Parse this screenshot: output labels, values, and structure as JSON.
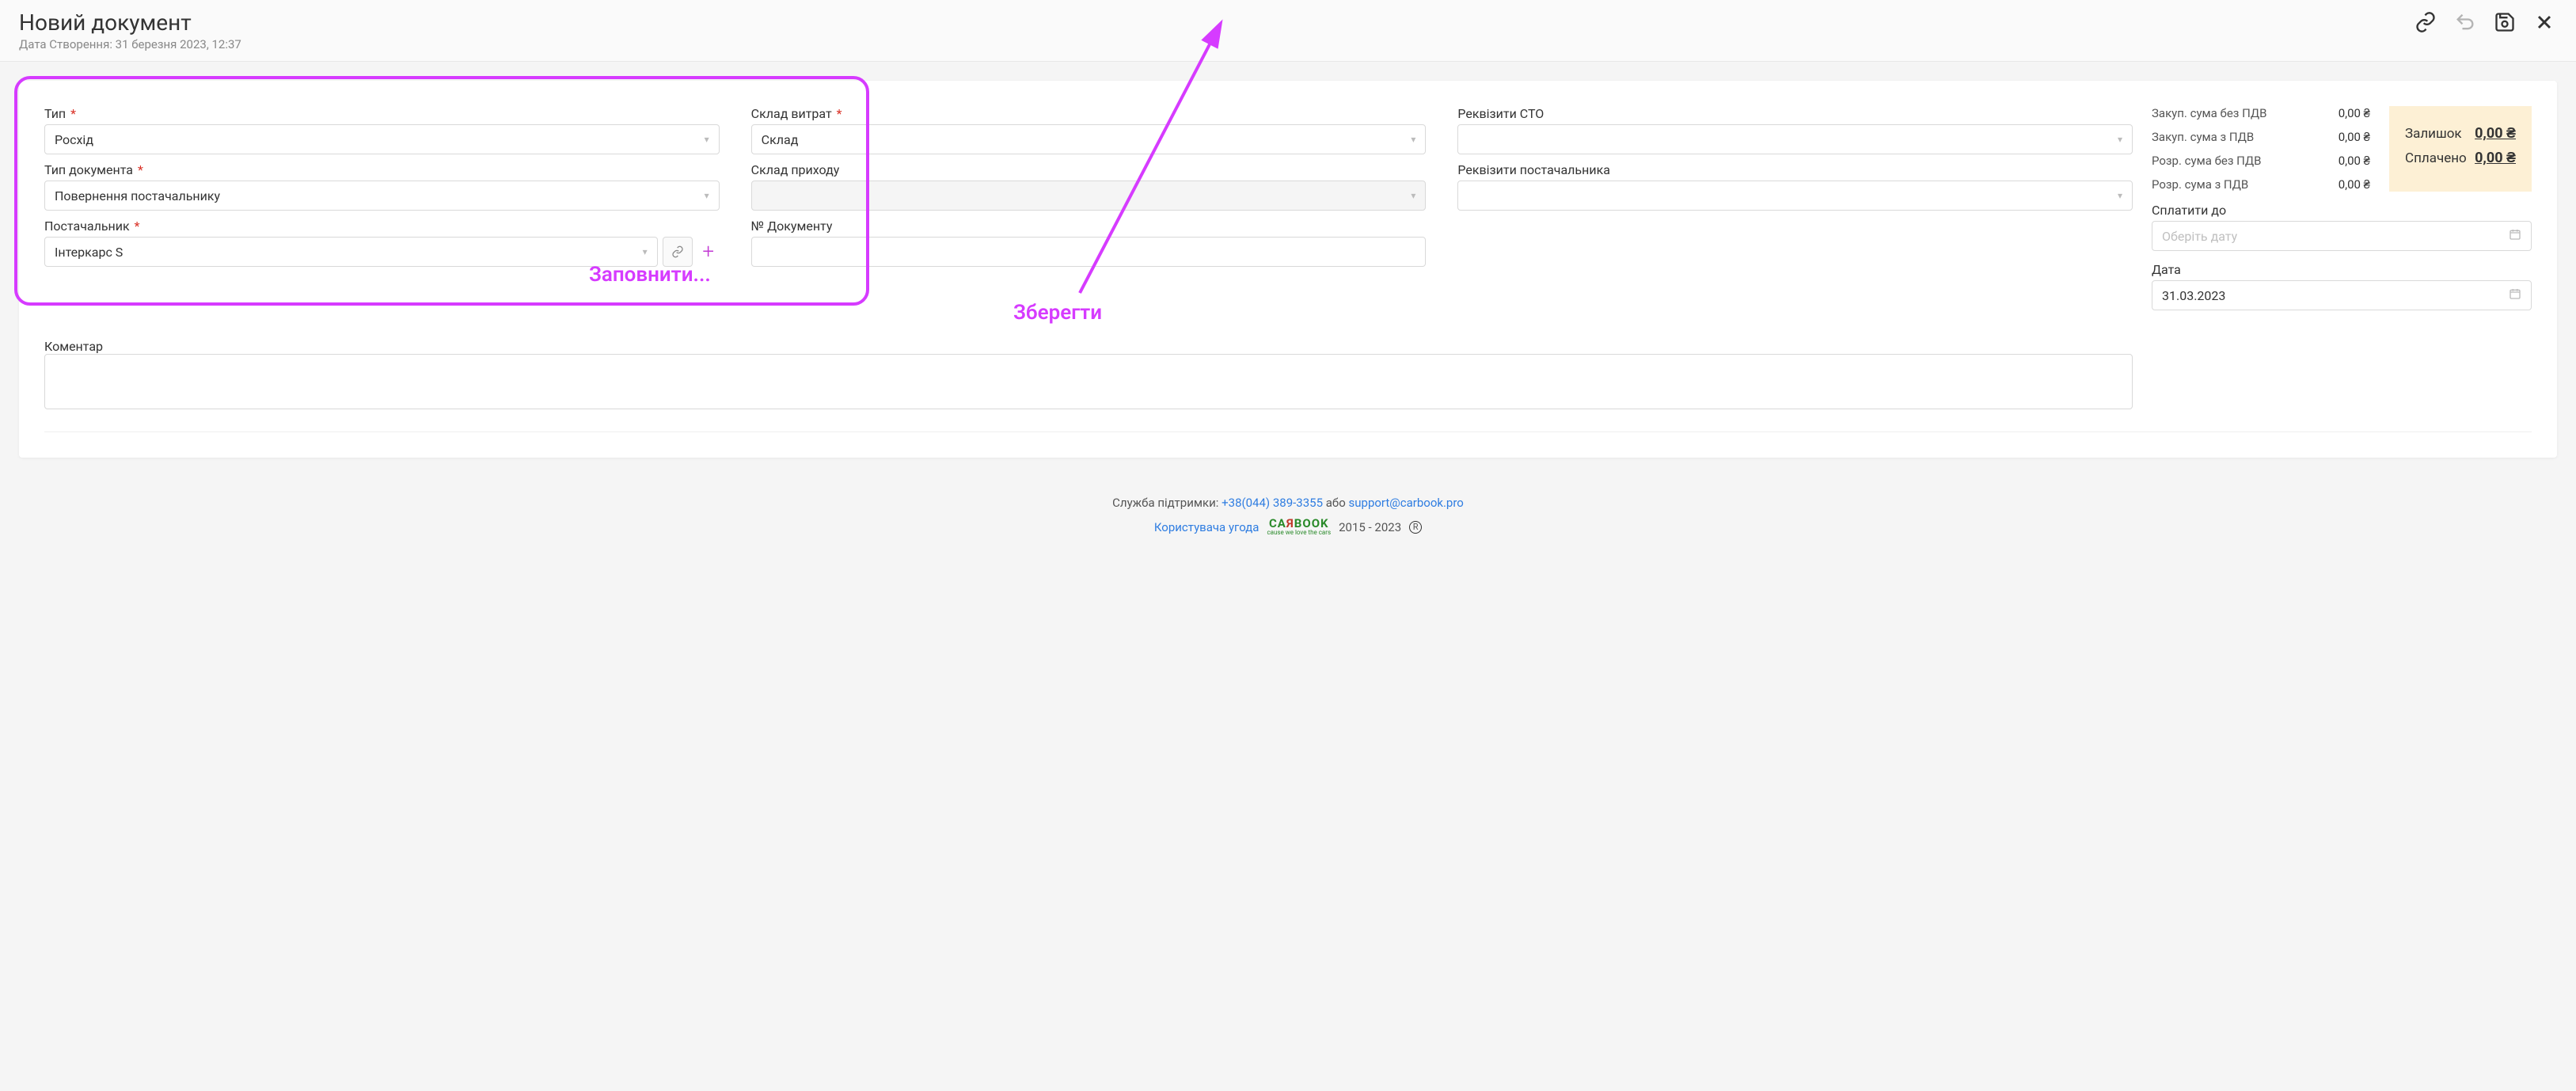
{
  "header": {
    "title": "Новий документ",
    "subtitle": "Дата Створення: 31 березня 2023, 12:37"
  },
  "form": {
    "type": {
      "label": "Тип",
      "required": true,
      "value": "Росхід"
    },
    "docType": {
      "label": "Тип документа",
      "required": true,
      "value": "Повернення постачальнику"
    },
    "supplier": {
      "label": "Постачальник",
      "required": true,
      "value": "Інтеркарс S"
    },
    "expenseWarehouse": {
      "label": "Склад витрат",
      "required": true,
      "value": "Склад"
    },
    "incomeWarehouse": {
      "label": "Склад приходу",
      "value": ""
    },
    "docNumber": {
      "label": "№ Документу",
      "value": ""
    },
    "stoRequisites": {
      "label": "Реквізити СТО",
      "value": ""
    },
    "supplierRequisites": {
      "label": "Реквізити постачальника",
      "value": ""
    },
    "comment": {
      "label": "Коментар",
      "value": ""
    }
  },
  "summary": {
    "rows": [
      {
        "label": "Закуп. сума без ПДВ",
        "value": "0,00 ₴"
      },
      {
        "label": "Закуп. сума з ПДВ",
        "value": "0,00 ₴"
      },
      {
        "label": "Розр. сума без ПДВ",
        "value": "0,00 ₴"
      },
      {
        "label": "Розр. сума з ПДВ",
        "value": "0,00 ₴"
      }
    ],
    "box": {
      "remaining": {
        "label": "Залишок",
        "value": "0,00 ₴"
      },
      "paid": {
        "label": "Сплачено",
        "value": "0,00 ₴"
      }
    },
    "payUntil": {
      "label": "Сплатити до",
      "placeholder": "Оберіть дату",
      "value": ""
    },
    "date": {
      "label": "Дата",
      "value": "31.03.2023"
    }
  },
  "annotations": {
    "fill": "Заповнити...",
    "save": "Зберегти"
  },
  "footer": {
    "supportLabel": "Служба підтримки:",
    "phone": "+38(044) 389-3355",
    "or": "або",
    "email": "support@carbook.pro",
    "agreement": "Користувача угода",
    "years": "2015 - 2023"
  }
}
